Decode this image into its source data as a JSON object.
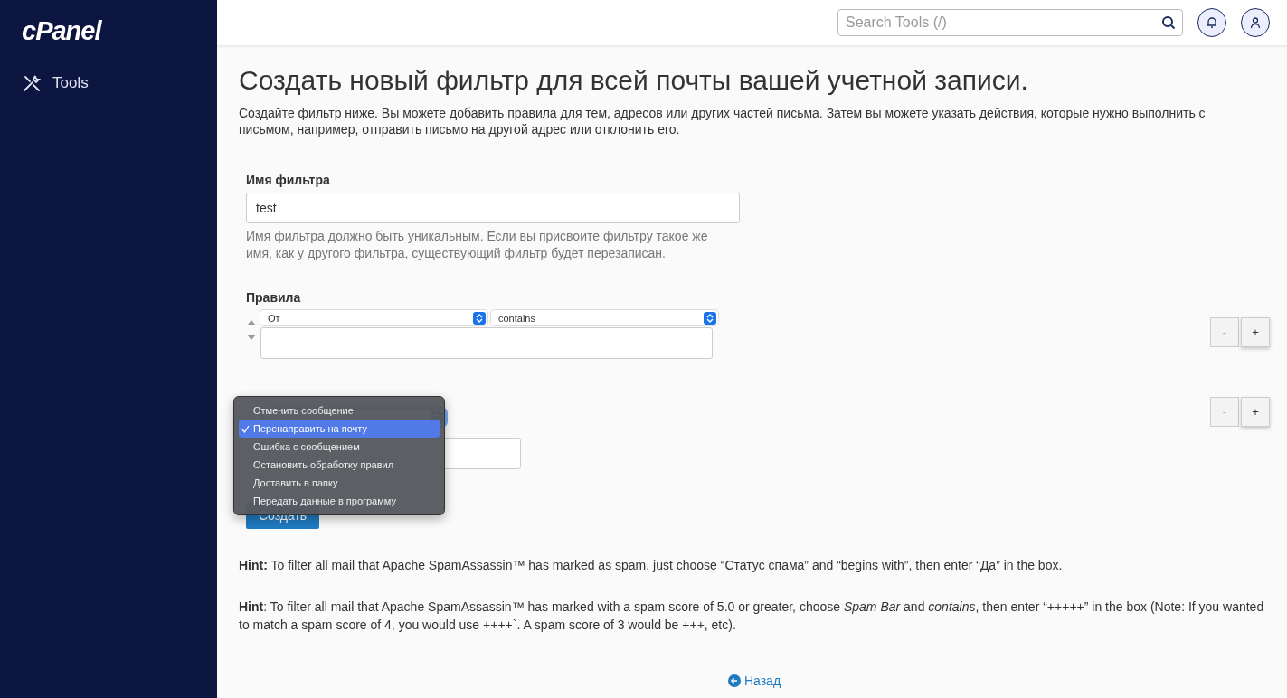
{
  "sidebar": {
    "logo": "cPanel",
    "items": [
      {
        "label": "Tools"
      }
    ]
  },
  "header": {
    "search": {
      "placeholder": "Search Tools (/)"
    }
  },
  "page": {
    "title": "Создать новый фильтр для всей почты вашей учетной записи.",
    "description": "Создайте фильтр ниже. Вы можете добавить правила для тем, адресов или других частей письма. Затем вы можете указать действия, которые нужно выполнить с письмом, например, отправить письмо на другой адрес или отклонить его."
  },
  "filter_name": {
    "label": "Имя фильтра",
    "value": "test",
    "help": "Имя фильтра должно быть уникальным. Если вы присвоите фильтру такое же имя, как у другого фильтра, существующий фильтр будет перезаписан."
  },
  "rules": {
    "label": "Правила",
    "rows": [
      {
        "field": "От",
        "operator": "contains",
        "remove": "-",
        "add": "+"
      }
    ]
  },
  "actions": {
    "rows": [
      {
        "remove": "-",
        "add": "+"
      }
    ],
    "dropdown": [
      {
        "label": "Отменить сообщение",
        "selected": false
      },
      {
        "label": "Перенаправить на почту",
        "selected": true
      },
      {
        "label": "Ошибка с сообщением",
        "selected": false
      },
      {
        "label": "Остановить обработку правил",
        "selected": false
      },
      {
        "label": "Доставить в папку",
        "selected": false
      },
      {
        "label": "Передать данные в программу",
        "selected": false
      }
    ]
  },
  "submit": "Создать",
  "hints": [
    "**Hint:** To filter all mail that Apache SpamAssassin™ has marked as spam, just choose “Статус спама” and “begins with”, then enter “Да” in the box.",
    "**Hint**: To filter all mail that Apache SpamAssassin™ has marked with a spam score of 5.0 or greater, choose *Spam Bar* and *contains*, then enter “+++++” in the box (Note: If you wanted to match a spam score of 4, you would use ++++`. A spam score of 3 would be +++, etc)."
  ],
  "back_link": "Назад"
}
